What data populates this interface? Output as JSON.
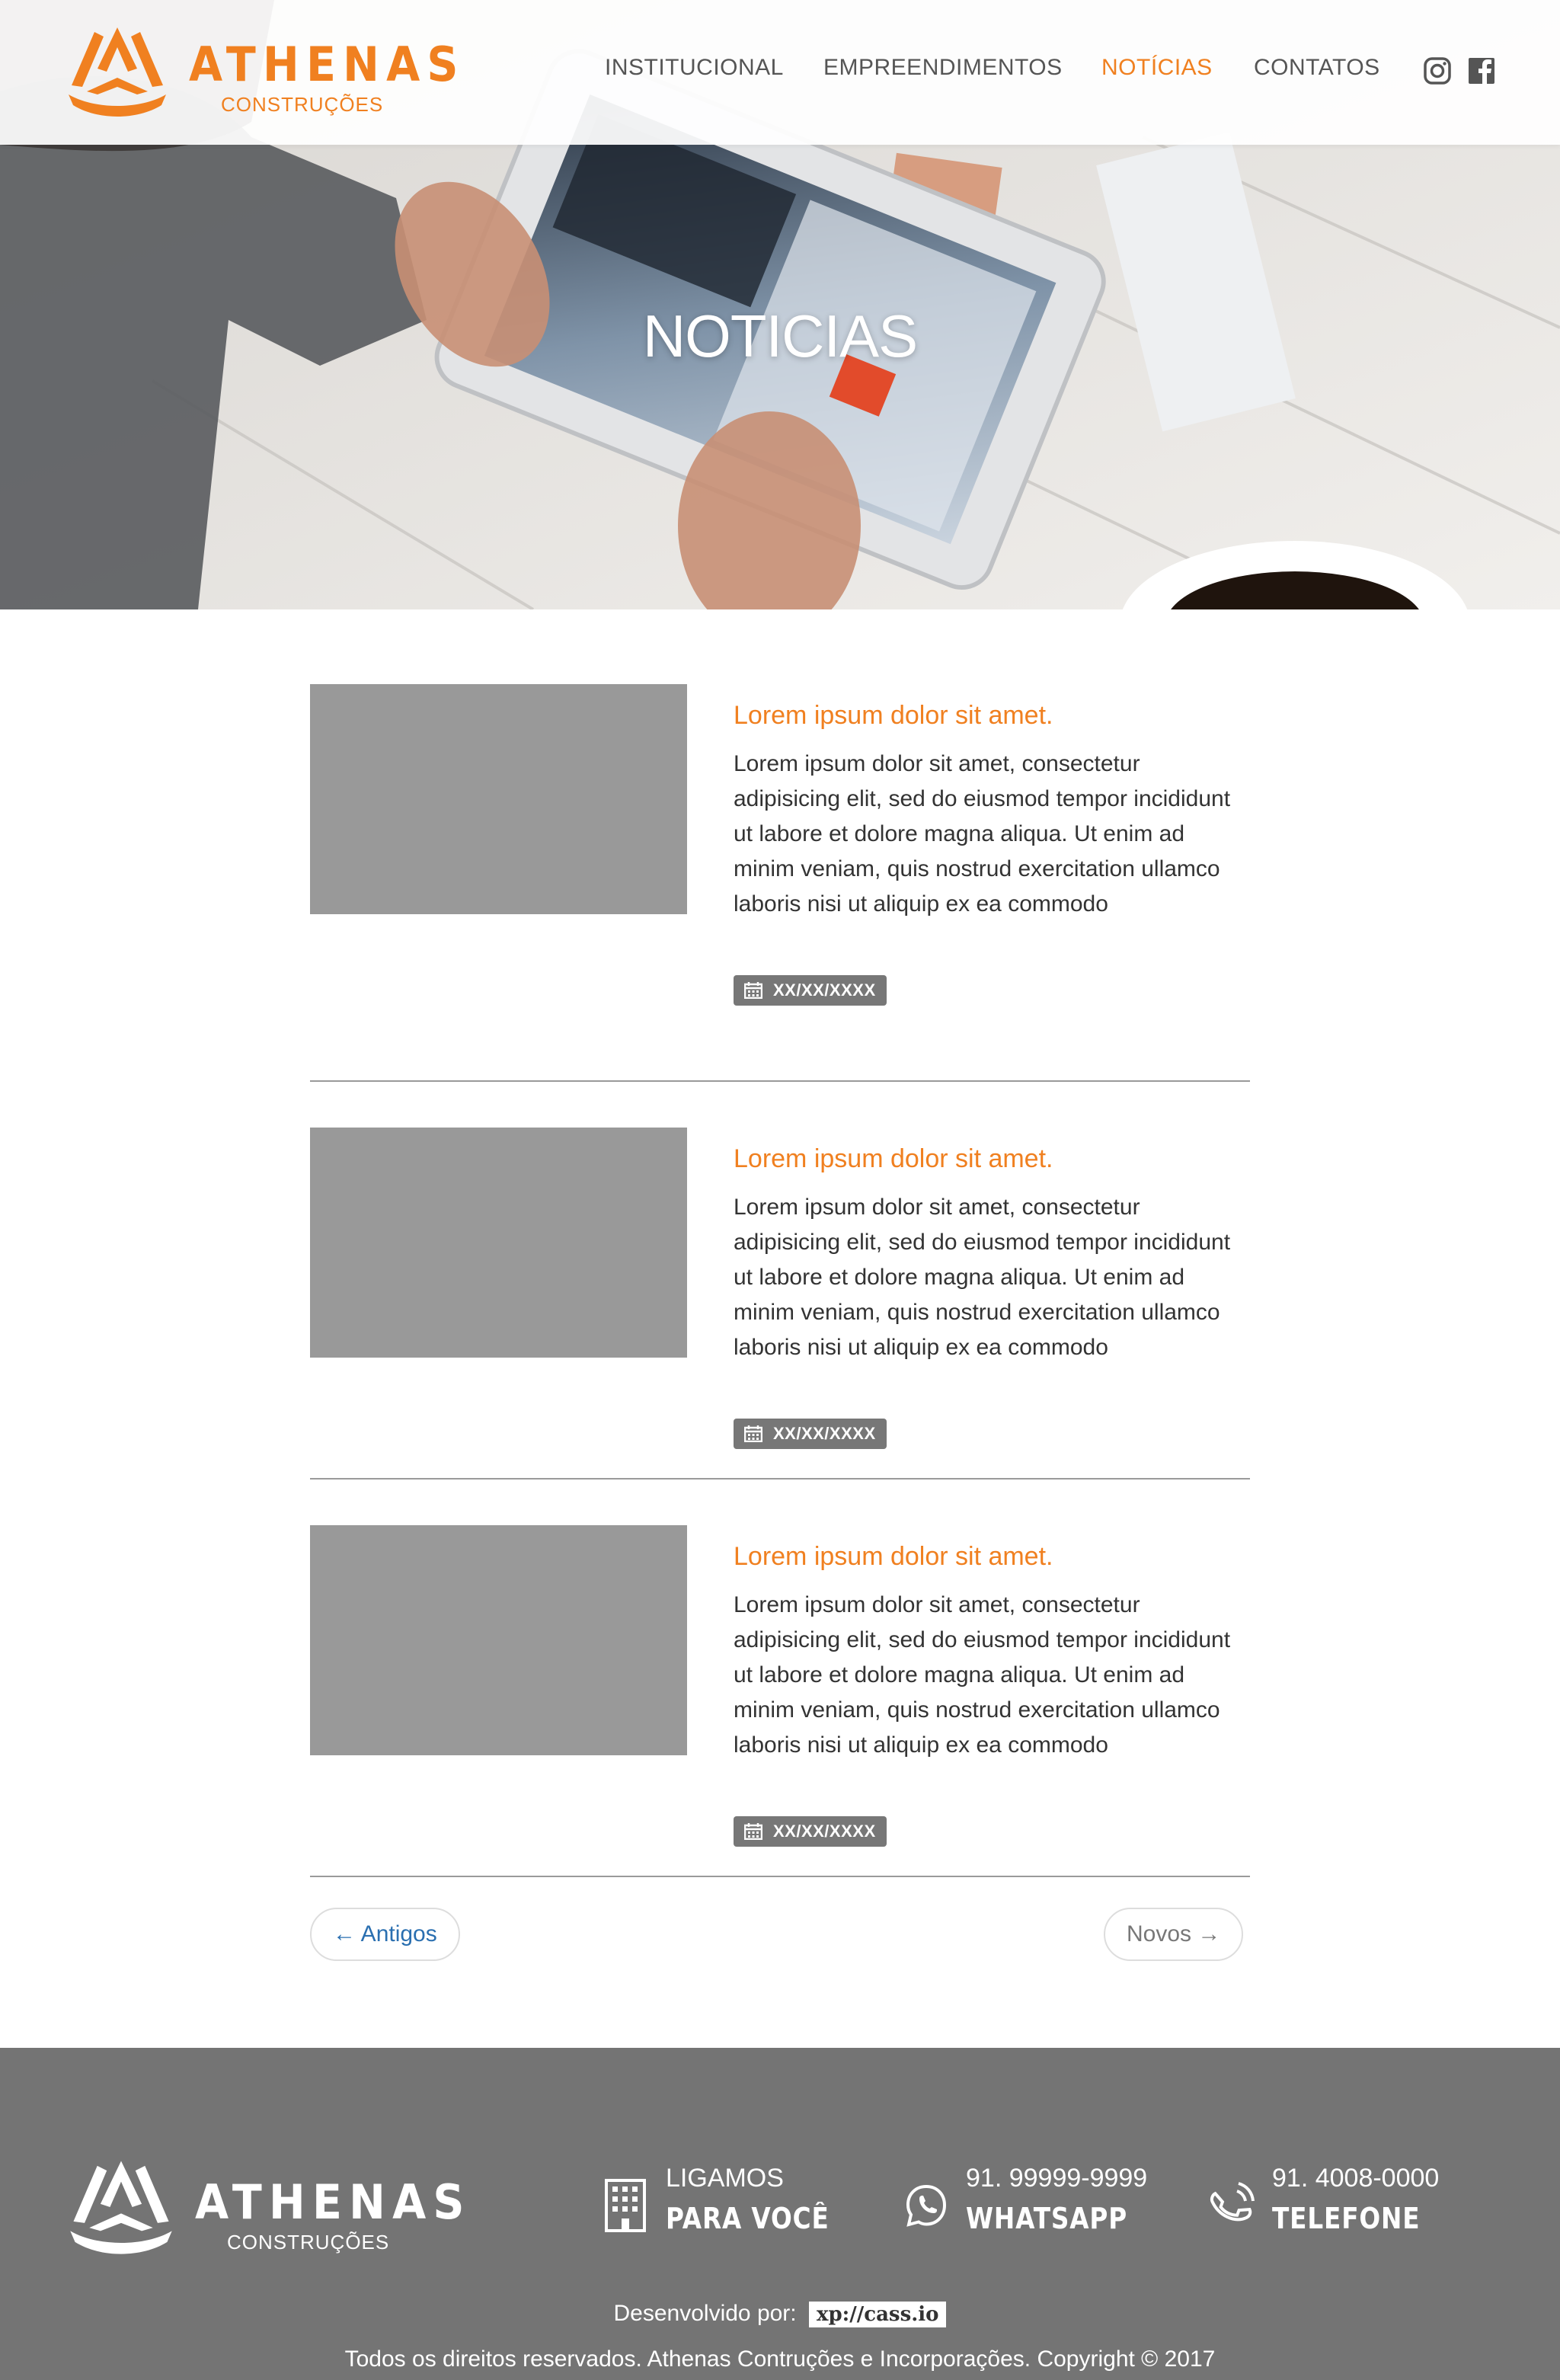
{
  "brand": {
    "name": "ATHENAS",
    "sub": "CONSTRUÇÕES",
    "accent": "#f08020"
  },
  "nav": {
    "items": [
      {
        "label": "INSTITUCIONAL"
      },
      {
        "label": "EMPREENDIMENTOS"
      },
      {
        "label": "NOTÍCIAS",
        "active": true
      },
      {
        "label": "CONTATOS"
      }
    ],
    "social_icons": [
      "instagram-icon",
      "facebook-icon"
    ]
  },
  "hero": {
    "title": "NOTICIAS"
  },
  "posts": [
    {
      "title": "Lorem ipsum dolor sit amet.",
      "text": "Lorem ipsum dolor sit amet, consectetur adipisicing elit, sed do eiusmod tempor incididunt ut labore et dolore magna aliqua. Ut enim ad minim veniam, quis nostrud exercitation ullamco laboris nisi ut aliquip ex ea commodo",
      "date": "XX/XX/XXXX"
    },
    {
      "title": "Lorem ipsum dolor sit amet.",
      "text": "Lorem ipsum dolor sit amet, consectetur adipisicing elit, sed do eiusmod tempor incididunt ut labore et dolore magna aliqua. Ut enim ad minim veniam, quis nostrud exercitation ullamco laboris nisi ut aliquip ex ea commodo",
      "date": "XX/XX/XXXX"
    },
    {
      "title": "Lorem ipsum dolor sit amet.",
      "text": "Lorem ipsum dolor sit amet, consectetur adipisicing elit, sed do eiusmod tempor incididunt ut labore et dolore magna aliqua. Ut enim ad minim veniam, quis nostrud exercitation ullamco laboris nisi ut aliquip ex ea commodo",
      "date": "XX/XX/XXXX"
    }
  ],
  "pager": {
    "older": "← Antigos",
    "newer": "Novos →"
  },
  "footer": {
    "brand_name": "ATHENAS",
    "brand_sub": "CONSTRUÇÕES",
    "contacts": [
      {
        "top": "LIGAMOS",
        "bottom": "PARA VOCÊ",
        "icon": "building-icon"
      },
      {
        "top": "91. 99999-9999",
        "bottom": "WHATSAPP",
        "icon": "whatsapp-icon"
      },
      {
        "top": "91. 4008-0000",
        "bottom": "TELEFONE",
        "icon": "phone-icon"
      }
    ],
    "developed_by": "Desenvolvido por:",
    "developer": "xp://cass.io",
    "copyright": "Todos os direitos reservados. Athenas Contruções e Incorporações. Copyright © 2017"
  }
}
